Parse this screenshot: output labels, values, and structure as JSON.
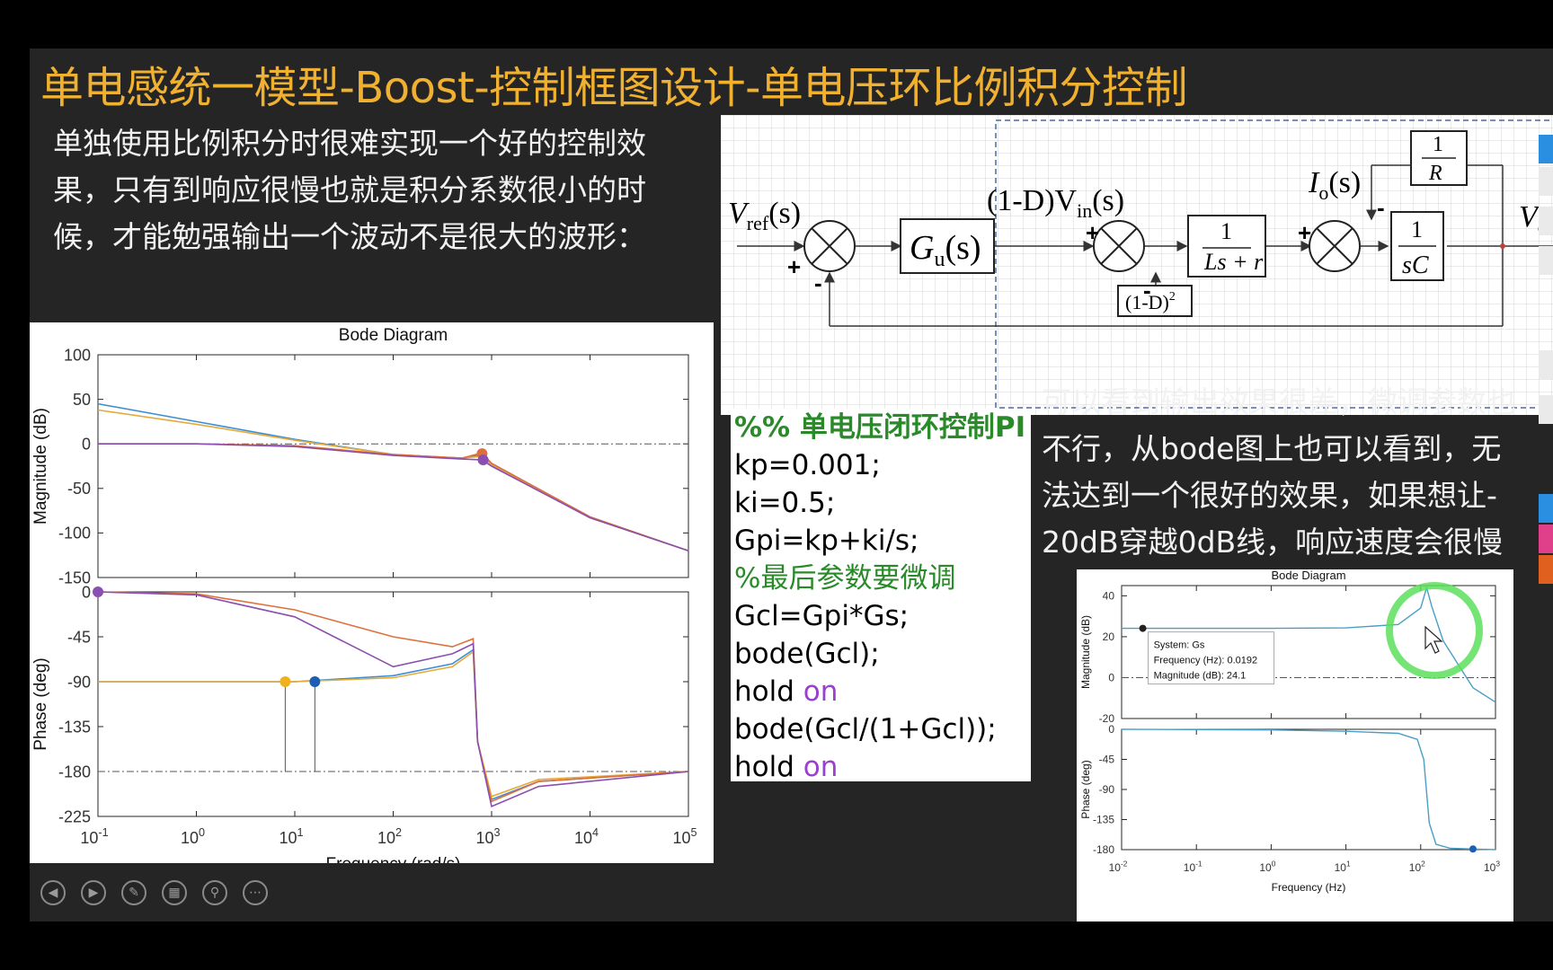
{
  "slide": {
    "title": "单电感统一模型-Boost-控制框图设计-单电压环比例积分控制",
    "paragraph1": "单独使用比例积分时很难实现一个好的控制效果，只有到响应很慢也就是积分系数很小的时候，才能勉强输出一个波动不是很大的波形：",
    "paragraph2_lines": [
      "可以看到输出效果很差，微调参数也",
      "不行，从bode图上也可以看到，无",
      "法达到一个很好的效果，如果想让-",
      "20dB穿越0dB线，响应速度会很慢"
    ]
  },
  "code": {
    "comment1": "%% 单电压闭环控制PI",
    "line_kp": "kp=0.001;",
    "line_ki": "ki=0.5;",
    "line_gpi": "Gpi=kp+ki/s;",
    "comment2": "%最后参数要微调",
    "line_gcl": "Gcl=Gpi*Gs;",
    "line_bode1": "bode(Gcl);",
    "hold_kw": "hold ",
    "on_kw": "on",
    "line_bode2": "bode(Gcl/(1+Gcl));"
  },
  "block_diagram": {
    "vref": "V",
    "vref_sub": "ref",
    "vref_arg": "(s)",
    "gu": "G",
    "gu_sub": "u",
    "gu_arg": "(s)",
    "top_label": "(1-D)V",
    "top_label_sub": "in",
    "top_label_arg": "(s)",
    "io": "I",
    "io_sub": "o",
    "io_arg": "(s)",
    "fb_gain": "(1-D)",
    "fb_gain_exp": "2",
    "inductor_num": "1",
    "inductor_den": "Ls + r",
    "cap_num": "1",
    "cap_den": "sC",
    "r_num": "1",
    "r_den": "R",
    "vo": "V",
    "vo_sub": "o",
    "plus": "+",
    "minus": "-"
  },
  "chart_data": [
    {
      "type": "line",
      "title": "Bode Diagram",
      "xlabel": "Frequency  (rad/s)",
      "x_scale": "log",
      "xlim": [
        0.1,
        100000
      ],
      "x_ticks": [
        "10",
        "10",
        "10",
        "10",
        "10",
        "10",
        "10"
      ],
      "x_tick_exps": [
        "-1",
        "0",
        "1",
        "2",
        "3",
        "4",
        "5"
      ],
      "panels": [
        {
          "ylabel": "Magnitude (dB)",
          "ylim": [
            -150,
            100
          ],
          "y_ticks": [
            "100",
            "50",
            "0",
            "-50",
            "-100",
            "-150"
          ],
          "y_tick_vals": [
            100,
            50,
            0,
            -50,
            -100,
            -150
          ],
          "reference_line": 0,
          "series": [
            {
              "color": "#3d8fd1",
              "x": [
                0.1,
                1,
                10,
                100,
                500,
                800,
                1000,
                10000,
                100000
              ],
              "y": [
                45,
                25,
                5,
                -12,
                -16,
                -12,
                -22,
                -82,
                -120
              ]
            },
            {
              "color": "#e6a93a",
              "x": [
                0.1,
                1,
                10,
                100,
                500,
                800,
                1000,
                10000,
                100000
              ],
              "y": [
                38,
                22,
                4,
                -12,
                -16,
                -14,
                -24,
                -83,
                -120
              ]
            },
            {
              "color": "#e0703a",
              "x": [
                0.1,
                1,
                10,
                100,
                500,
                800,
                1000,
                10000,
                100000
              ],
              "y": [
                0,
                0,
                -2,
                -12,
                -16,
                -10,
                -22,
                -82,
                -120
              ]
            },
            {
              "color": "#8a4fb0",
              "x": [
                0.1,
                1,
                10,
                100,
                500,
                800,
                1000,
                10000,
                100000
              ],
              "y": [
                0,
                0,
                -3,
                -13,
                -17,
                -18,
                -25,
                -83,
                -120
              ]
            }
          ],
          "markers": [
            {
              "color": "#e0703a",
              "x": 800,
              "y": -11
            },
            {
              "color": "#8a4fb0",
              "x": 820,
              "y": -18
            }
          ]
        },
        {
          "ylabel": "Phase (deg)",
          "ylim": [
            -225,
            0
          ],
          "y_ticks": [
            "0",
            "-45",
            "-90",
            "-135",
            "-180",
            "-225"
          ],
          "y_tick_vals": [
            0,
            -45,
            -90,
            -135,
            -180,
            -225
          ],
          "reference_line": -180,
          "series": [
            {
              "color": "#3d8fd1",
              "x": [
                0.1,
                10,
                100,
                400,
                650,
                720,
                1000,
                3000,
                100000
              ],
              "y": [
                -90,
                -90,
                -84,
                -72,
                -58,
                -150,
                -208,
                -190,
                -180
              ]
            },
            {
              "color": "#e6a93a",
              "x": [
                0.1,
                10,
                100,
                400,
                650,
                720,
                1000,
                3000,
                100000
              ],
              "y": [
                -90,
                -90,
                -86,
                -75,
                -60,
                -150,
                -205,
                -188,
                -180
              ]
            },
            {
              "color": "#e0703a",
              "x": [
                0.1,
                1,
                10,
                100,
                400,
                650,
                720,
                1000,
                3000,
                100000
              ],
              "y": [
                0,
                -2,
                -18,
                -45,
                -55,
                -47,
                -150,
                -210,
                -190,
                -180
              ]
            },
            {
              "color": "#8a4fb0",
              "x": [
                0.1,
                1,
                10,
                100,
                400,
                650,
                720,
                1000,
                3000,
                100000
              ],
              "y": [
                0,
                -3,
                -25,
                -75,
                -62,
                -52,
                -150,
                -215,
                -195,
                -180
              ]
            }
          ],
          "markers": [
            {
              "color": "#f0b020",
              "x": 8,
              "y": -90
            },
            {
              "color": "#1a5fb4",
              "x": 16,
              "y": -90
            },
            {
              "color": "#8a4fb0",
              "x": 0.1,
              "y": 0
            }
          ],
          "stems": [
            8,
            16
          ]
        }
      ]
    },
    {
      "type": "line",
      "title": "Bode Diagram",
      "xlabel": "Frequency  (Hz)",
      "x_scale": "log",
      "xlim": [
        0.01,
        1000
      ],
      "x_ticks": [
        "10",
        "10",
        "10",
        "10",
        "10",
        "10"
      ],
      "x_tick_exps": [
        "-2",
        "-1",
        "0",
        "1",
        "2",
        "3"
      ],
      "panels": [
        {
          "ylabel": "Magnitude (dB)",
          "ylim": [
            -20,
            45
          ],
          "y_ticks": [
            "40",
            "20",
            "0",
            "-20"
          ],
          "y_tick_vals": [
            40,
            20,
            0,
            -20
          ],
          "reference_line": 0,
          "series": [
            {
              "color": "#4a9ec4",
              "x": [
                0.01,
                0.0192,
                1,
                10,
                50,
                100,
                120,
                140,
                200,
                500,
                1000
              ],
              "y": [
                24.1,
                24.1,
                24.1,
                24.3,
                26,
                34,
                44,
                35,
                18,
                -5,
                -12
              ]
            }
          ],
          "markers": [
            {
              "color": "#222222",
              "x": 0.0192,
              "y": 24.1
            }
          ],
          "datatip": {
            "line1": "System: Gs",
            "line2": "Frequency (Hz): 0.0192",
            "line3": "Magnitude (dB): 24.1"
          }
        },
        {
          "ylabel": "Phase (deg)",
          "ylim": [
            -180,
            0
          ],
          "y_ticks": [
            "0",
            "-45",
            "-90",
            "-135",
            "-180"
          ],
          "y_tick_vals": [
            0,
            -45,
            -90,
            -135,
            -180
          ],
          "series": [
            {
              "color": "#4a9ec4",
              "x": [
                0.01,
                1,
                10,
                50,
                90,
                110,
                130,
                160,
                250,
                1000
              ],
              "y": [
                0,
                -1,
                -3,
                -6,
                -15,
                -45,
                -140,
                -172,
                -178,
                -180
              ]
            }
          ],
          "markers": [
            {
              "color": "#1a5fb4",
              "x": 500,
              "y": -179
            }
          ]
        }
      ]
    }
  ],
  "colors": {
    "title": "#f0b030",
    "slide_bg": "#252526",
    "highlight_ring": "#5ce05c"
  },
  "toolbar": {
    "icons": [
      "prev-slide-icon",
      "next-slide-icon",
      "pen-icon",
      "slides-grid-icon",
      "zoom-icon",
      "more-icon"
    ]
  }
}
